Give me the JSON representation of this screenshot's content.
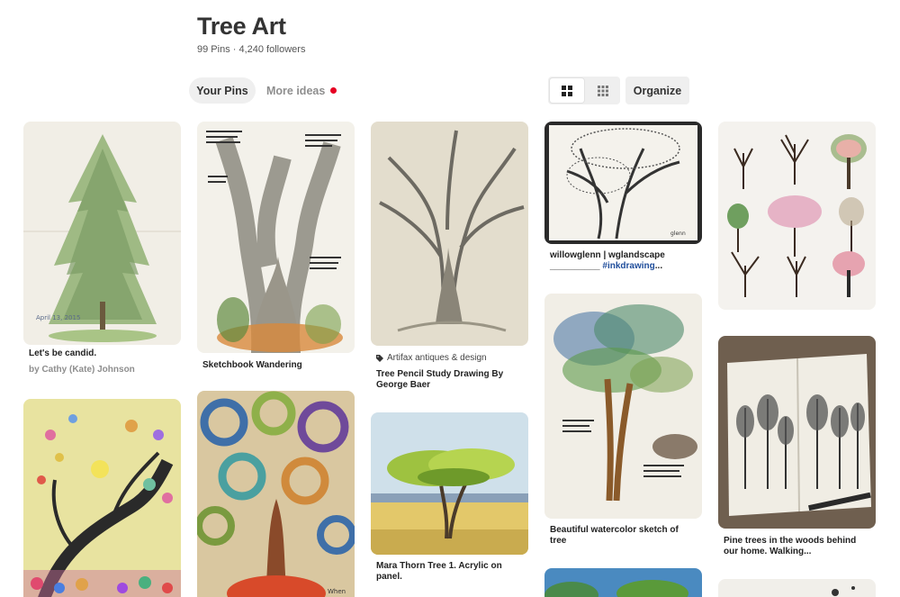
{
  "board": {
    "title": "Tree Art",
    "meta": "99 Pins · 4,240 followers"
  },
  "tabs": {
    "your_pins": "Your Pins",
    "more_ideas": "More ideas"
  },
  "toolbar": {
    "organize": "Organize",
    "view_large_icon": "grid-large-icon",
    "view_compact_icon": "grid-compact-icon"
  },
  "colors": {
    "notification_dot": "#e60023",
    "hashtag": "#1f4d9b"
  },
  "pins": [
    {
      "caption": "Let's be candid.",
      "sub": "by Cathy (Kate) Johnson"
    },
    {
      "caption": "Sketchbook Wandering"
    },
    {
      "source": "Artifax antiques & design",
      "caption": "Tree Pencil Study Drawing By George Baer"
    },
    {
      "caption_line1": "willowglenn | wglandscape",
      "caption_prefix": "__________ ",
      "caption_hashtag": "#inkdrawing",
      "caption_suffix": "..."
    },
    {
      "caption": ""
    },
    {
      "caption": ""
    },
    {
      "caption": ""
    },
    {
      "caption": "Mara Thorn Tree 1. Acrylic on panel."
    },
    {
      "caption": "Beautiful watercolor sketch of tree"
    },
    {
      "caption": "Pine trees in the woods behind our home. Walking..."
    },
    {
      "caption": ""
    },
    {
      "caption": ""
    }
  ]
}
